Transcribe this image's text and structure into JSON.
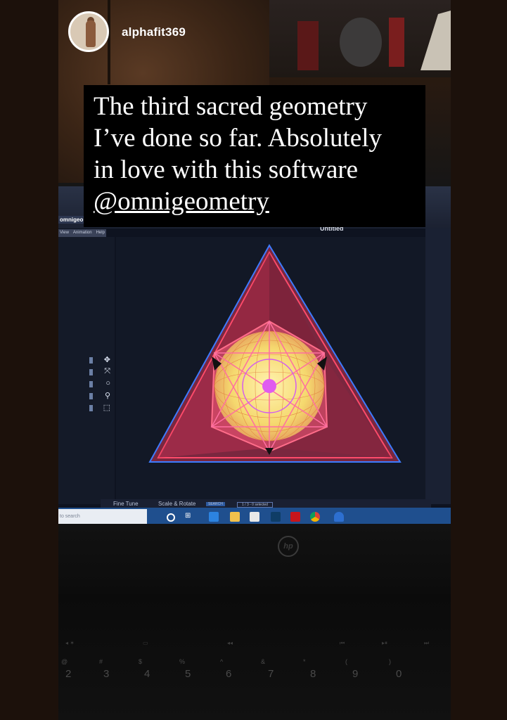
{
  "story": {
    "username": "alphafit369",
    "caption_lines": [
      "The third sacred geometry",
      "I’ve done so far. Absolutely",
      "in love with this software"
    ],
    "mention": "@omnigeometry"
  },
  "app": {
    "title": "omnigeo",
    "menu": [
      "View",
      "Animation",
      "Help"
    ],
    "document_title": "Untitled",
    "tools": [
      "move-icon",
      "scale-icon",
      "rotate-icon",
      "zoom-icon",
      "select-icon"
    ],
    "status": {
      "fine_tune": "Fine Tune",
      "scale_rotate": "Scale & Rotate",
      "search": "SEARCH",
      "selection": "1 / 3 - 0 selected"
    }
  },
  "taskbar": {
    "search_placeholder": "to search",
    "icons": [
      "cortana-icon",
      "task-view-icon",
      "edge-icon",
      "file-explorer-icon",
      "store-icon",
      "app-icon",
      "netflix-icon",
      "chrome-icon",
      "omni-icon"
    ]
  },
  "laptop": {
    "brand": "hp",
    "number_keys": [
      "2",
      "3",
      "4",
      "5",
      "6",
      "7",
      "8",
      "9",
      "0"
    ],
    "shift_symbols": [
      "@",
      "#",
      "$",
      "%",
      "^",
      "&",
      "*",
      "(",
      ")"
    ]
  },
  "colors": {
    "caption_bg": "#000000",
    "triangle_outline": "#3d7bff",
    "triangle_fill": "#e8405f",
    "sphere": "#f7e07a",
    "center": "#e05cf0",
    "taskbar": "#1f4f8e"
  }
}
